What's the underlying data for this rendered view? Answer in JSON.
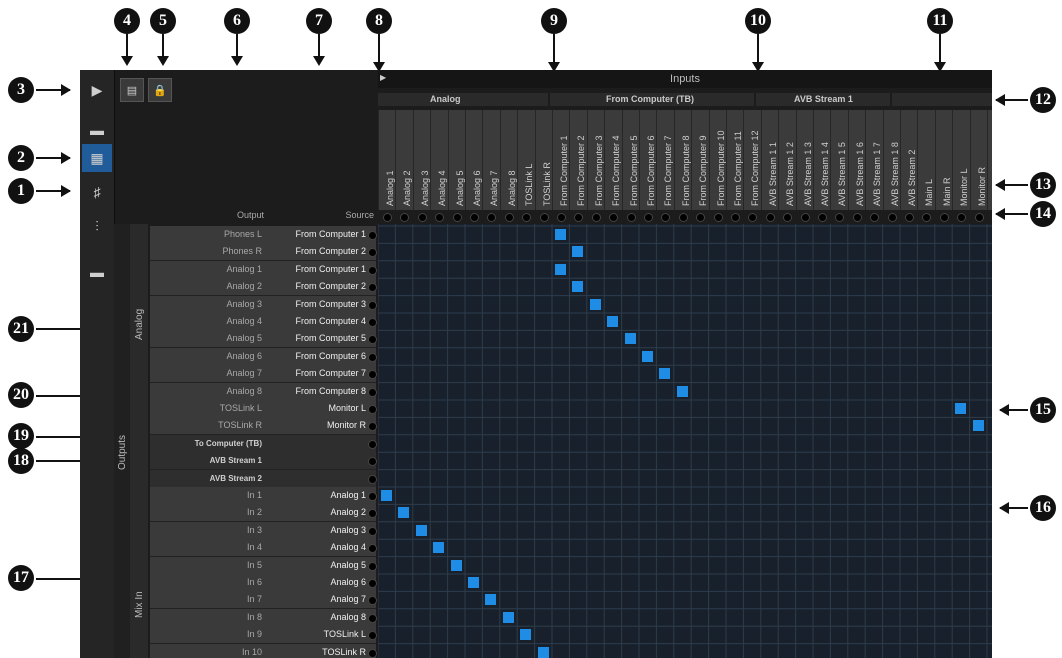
{
  "callouts": [
    "1",
    "2",
    "3",
    "4",
    "5",
    "6",
    "7",
    "8",
    "9",
    "10",
    "11",
    "12",
    "13",
    "14",
    "15",
    "16",
    "17",
    "18",
    "19",
    "20",
    "21"
  ],
  "headers": {
    "inputs": "Inputs",
    "output": "Output",
    "source": "Source",
    "outputs_vertical": "Outputs",
    "analog_vertical": "Analog",
    "mixin_vertical": "Mix In"
  },
  "groups": {
    "analog": "Analog",
    "from_computer": "From Computer (TB)",
    "avb1": "AVB Stream 1",
    "avb2": "AVB Stream 2"
  },
  "columns": [
    "Analog 1",
    "Analog 2",
    "Analog 3",
    "Analog 4",
    "Analog 5",
    "Analog 6",
    "Analog 7",
    "Analog 8",
    "TOSLink L",
    "TOSLink R",
    "From Computer 1",
    "From Computer 2",
    "From Computer 3",
    "From Computer 4",
    "From Computer 5",
    "From Computer 6",
    "From Computer 7",
    "From Computer 8",
    "From Computer 9",
    "From Computer 10",
    "From Computer 11",
    "From Computer 12",
    "AVB Stream 1 1",
    "AVB Stream 1 2",
    "AVB Stream 1 3",
    "AVB Stream 1 4",
    "AVB Stream 1 5",
    "AVB Stream 1 6",
    "AVB Stream 1 7",
    "AVB Stream 1 8",
    "AVB Stream 2",
    "Main L",
    "Main R",
    "Monitor L",
    "Monitor R",
    "Aux 1"
  ],
  "rows": [
    {
      "out": "Phones L",
      "src": "From Computer 1",
      "sub": false,
      "col": 10
    },
    {
      "out": "Phones R",
      "src": "From Computer 2",
      "sub": false,
      "col": 11
    },
    {
      "out": "Analog 1",
      "src": "From Computer 1",
      "sub": false,
      "col": 10
    },
    {
      "out": "Analog 2",
      "src": "From Computer 2",
      "sub": false,
      "col": 11
    },
    {
      "out": "Analog 3",
      "src": "From Computer 3",
      "sub": false,
      "col": 12
    },
    {
      "out": "Analog 4",
      "src": "From Computer 4",
      "sub": false,
      "col": 13
    },
    {
      "out": "Analog 5",
      "src": "From Computer 5",
      "sub": false,
      "col": 14
    },
    {
      "out": "Analog 6",
      "src": "From Computer 6",
      "sub": false,
      "col": 15
    },
    {
      "out": "Analog 7",
      "src": "From Computer 7",
      "sub": false,
      "col": 16
    },
    {
      "out": "Analog 8",
      "src": "From Computer 8",
      "sub": false,
      "col": 17
    },
    {
      "out": "TOSLink L",
      "src": "Monitor L",
      "sub": false,
      "col": 33
    },
    {
      "out": "TOSLink R",
      "src": "Monitor R",
      "sub": false,
      "col": 34
    },
    {
      "out": "To Computer (TB)",
      "src": "",
      "sub": true,
      "col": -1
    },
    {
      "out": "AVB Stream 1",
      "src": "",
      "sub": true,
      "col": -1
    },
    {
      "out": "AVB Stream 2",
      "src": "",
      "sub": true,
      "col": -1
    },
    {
      "out": "In 1",
      "src": "Analog 1",
      "sub": false,
      "col": 0
    },
    {
      "out": "In 2",
      "src": "Analog 2",
      "sub": false,
      "col": 1
    },
    {
      "out": "In 3",
      "src": "Analog 3",
      "sub": false,
      "col": 2
    },
    {
      "out": "In 4",
      "src": "Analog 4",
      "sub": false,
      "col": 3
    },
    {
      "out": "In 5",
      "src": "Analog 5",
      "sub": false,
      "col": 4
    },
    {
      "out": "In 6",
      "src": "Analog 6",
      "sub": false,
      "col": 5
    },
    {
      "out": "In 7",
      "src": "Analog 7",
      "sub": false,
      "col": 6
    },
    {
      "out": "In 8",
      "src": "Analog 8",
      "sub": false,
      "col": 7
    },
    {
      "out": "In 9",
      "src": "TOSLink L",
      "sub": false,
      "col": 8
    },
    {
      "out": "In 10",
      "src": "TOSLink R",
      "sub": false,
      "col": 9
    }
  ],
  "colors": {
    "accent": "#1f8de6",
    "active_tab": "#1f5c99"
  }
}
